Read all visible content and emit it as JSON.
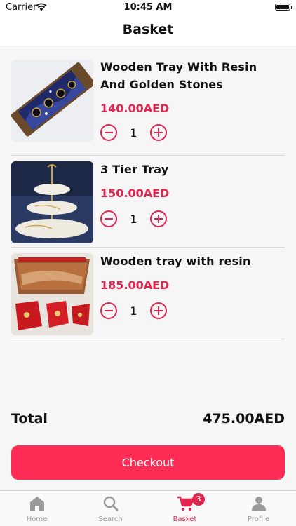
{
  "status_bar": {
    "carrier": "Carrier",
    "time": "10:45 AM"
  },
  "nav": {
    "title": "Basket"
  },
  "items": [
    {
      "name": "Wooden Tray With Resin And Golden Stones",
      "price": "140.00AED",
      "quantity": "1"
    },
    {
      "name": "3 Tier Tray",
      "price": "150.00AED",
      "quantity": "1"
    },
    {
      "name": "Wooden tray with resin",
      "price": "185.00AED",
      "quantity": "1"
    }
  ],
  "total": {
    "label": "Total",
    "value": "475.00AED"
  },
  "checkout": {
    "label": "Checkout"
  },
  "tabs": [
    {
      "label": "Home",
      "icon": "home-icon"
    },
    {
      "label": "Search",
      "icon": "search-icon"
    },
    {
      "label": "Basket",
      "icon": "cart-icon",
      "badge": "3",
      "active": true
    },
    {
      "label": "Profile",
      "icon": "person-icon"
    }
  ],
  "colors": {
    "accent": "#e0254f",
    "button": "#ff2d55",
    "inactive": "#9a9a9a"
  }
}
